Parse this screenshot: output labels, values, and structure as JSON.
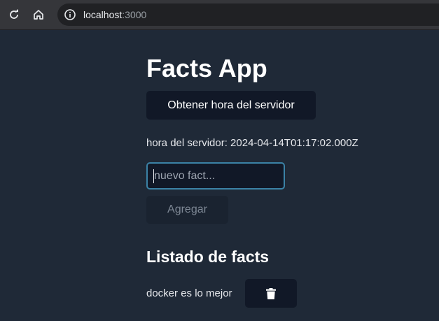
{
  "browser": {
    "url_host": "localhost",
    "url_port": ":3000",
    "icons": [
      "reload-icon",
      "home-icon",
      "info-icon"
    ]
  },
  "app": {
    "title": "Facts App",
    "server_button_label": "Obtener hora del servidor",
    "server_time_text": "hora del servidor: 2024-04-14T01:17:02.000Z",
    "fact_input_placeholder": "nuevo fact...",
    "fact_input_value": "",
    "add_button_label": "Agregar",
    "list_title": "Listado de facts",
    "facts": [
      {
        "text": "docker es lo mejor",
        "delete_icon": "trash-icon"
      }
    ]
  },
  "colors": {
    "background": "#1f2937",
    "button_dark": "#111827",
    "input_focus_border": "#3b82a6"
  }
}
